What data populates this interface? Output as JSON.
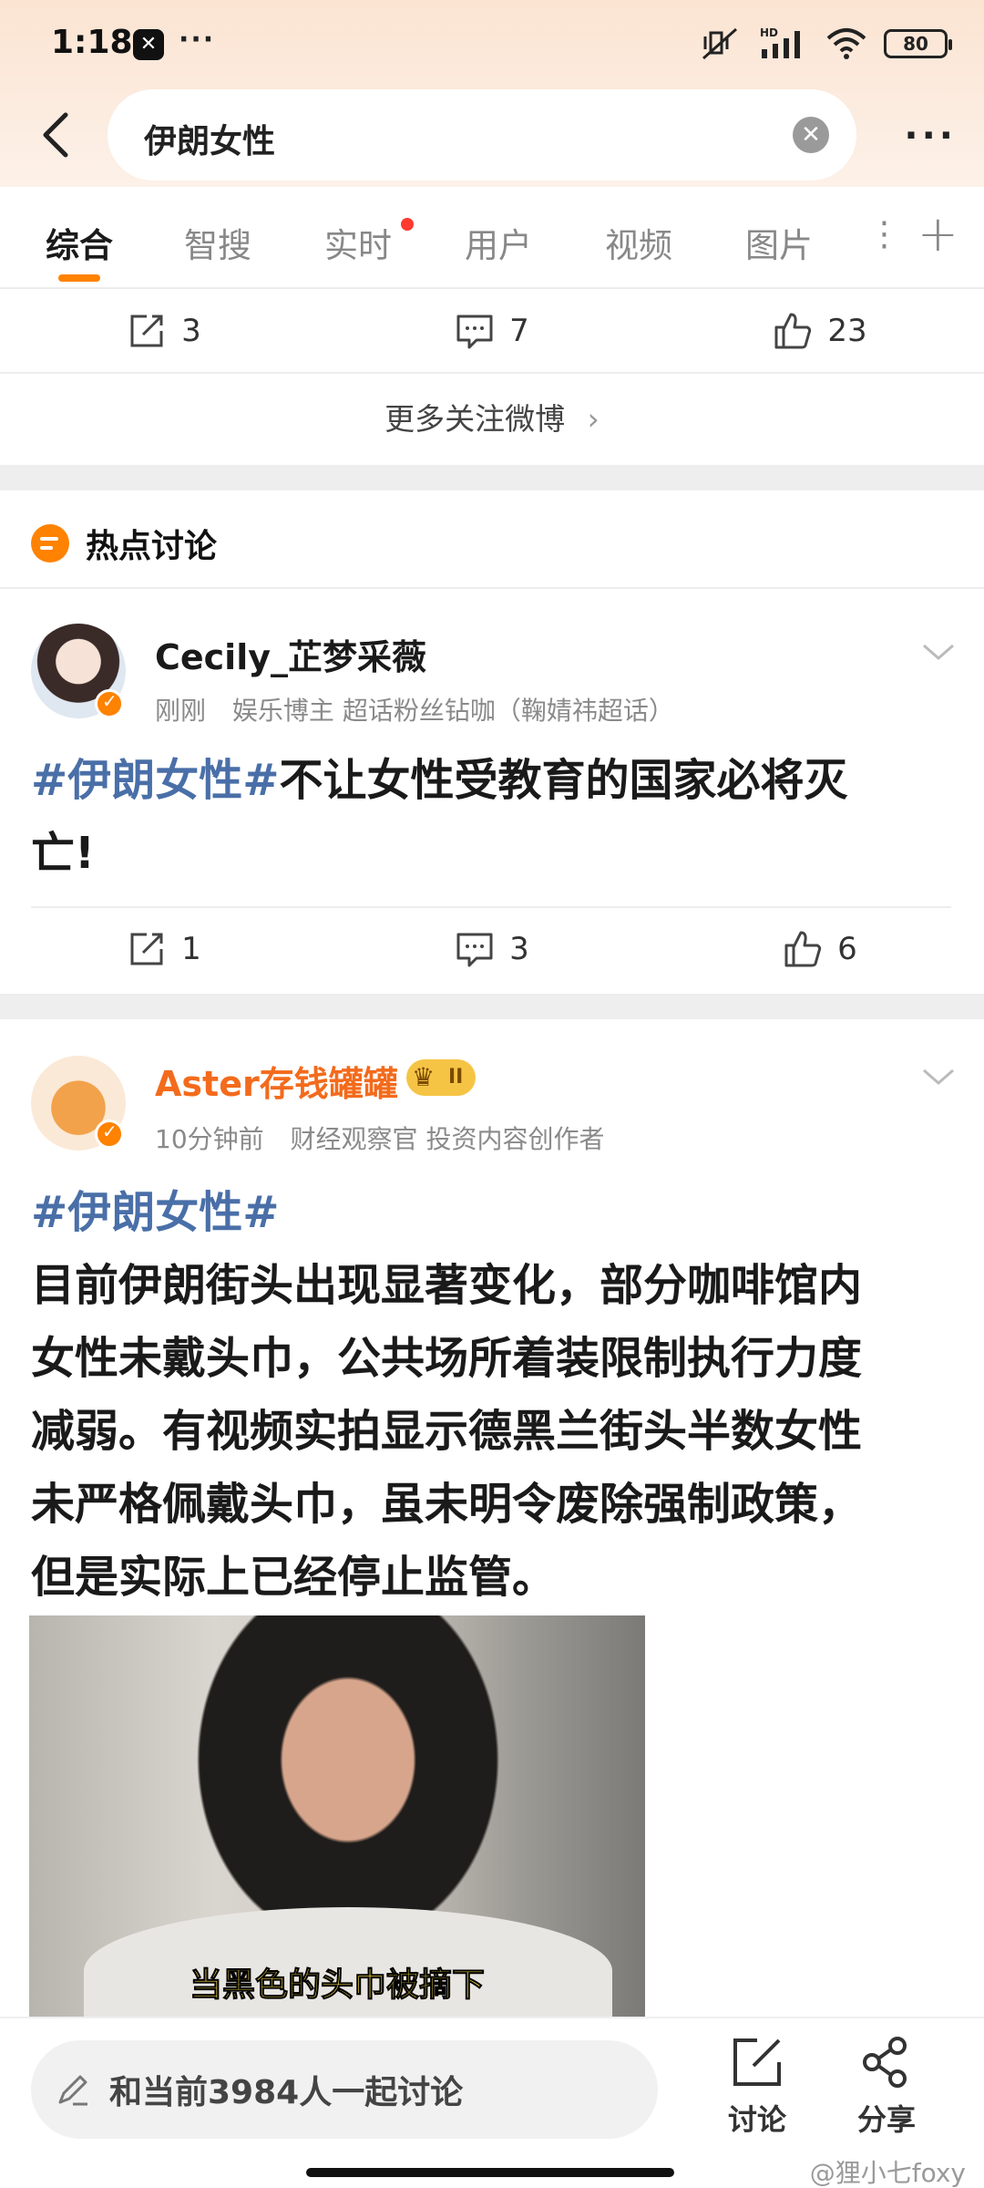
{
  "status_bar": {
    "time": "1:18",
    "app_icon_label": "✕",
    "overflow": "···",
    "battery": "80"
  },
  "search": {
    "query": "伊朗女性"
  },
  "tabs": [
    {
      "label": "综合",
      "active": true
    },
    {
      "label": "智搜"
    },
    {
      "label": "实时",
      "has_dot": true
    },
    {
      "label": "用户"
    },
    {
      "label": "视频"
    },
    {
      "label": "图片"
    }
  ],
  "prev_post_actions": {
    "repost": "3",
    "comment": "7",
    "like": "23"
  },
  "more_follow": "更多关注微博",
  "hot_section": {
    "title": "热点讨论"
  },
  "posts": [
    {
      "user": "Cecily_芷梦采薇",
      "time": "刚刚",
      "meta": "娱乐博主 超话粉丝钻咖（鞠婧祎超话）",
      "hashtag": "#伊朗女性#",
      "text_line1": "不让女性受教育的国家必将灭",
      "text_line2": "亡!",
      "actions": {
        "repost": "1",
        "comment": "3",
        "like": "6"
      }
    },
    {
      "user": "Aster存钱罐罐",
      "time": "10分钟前",
      "meta": "财经观察官 投资内容创作者",
      "badge": "II",
      "hashtag": "#伊朗女性#",
      "lines": [
        "目前伊朗街头出现显著变化，部分咖啡馆内",
        "女性未戴头巾，公共场所着装限制执行力度",
        "减弱。有视频实拍显示德黑兰街头半数女性",
        "未严格佩戴头巾，虽未明令废除强制政策，",
        "但是实际上已经停止监管。"
      ],
      "video_caption": "当黑色的头巾被摘下"
    }
  ],
  "bottom_bar": {
    "input_placeholder": "和当前3984人一起讨论",
    "discuss_label": "讨论",
    "share_label": "分享"
  },
  "watermark": "@狸小七foxy",
  "colors": {
    "accent": "#ff8200",
    "hashtag": "#4a6fa8",
    "header_bg": "#fce7d6"
  }
}
